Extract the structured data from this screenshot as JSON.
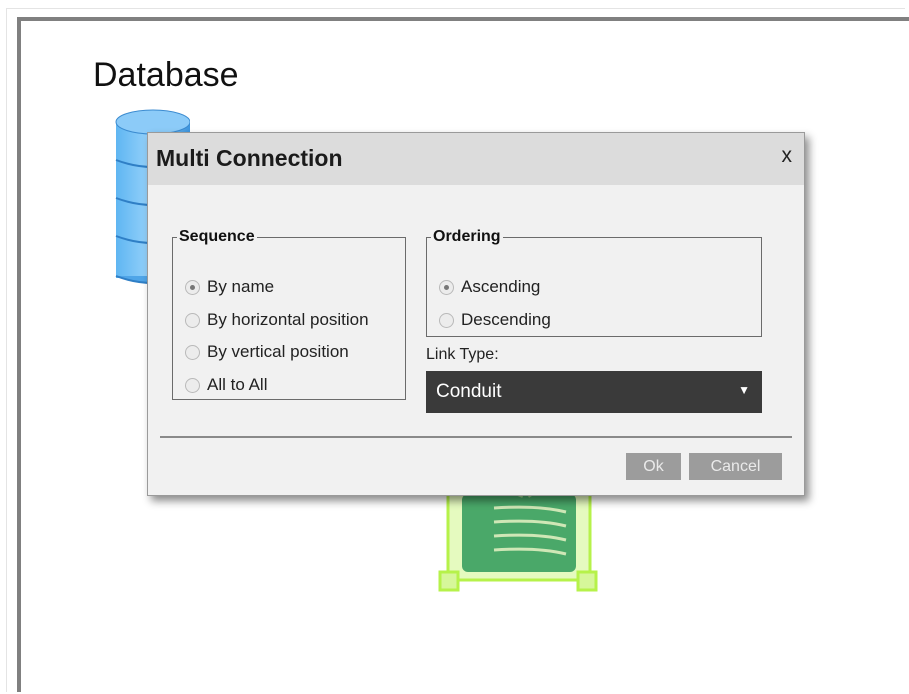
{
  "canvas": {
    "title": "Database"
  },
  "icons": {
    "database": "database-icon",
    "router": "router-icon"
  },
  "dialog": {
    "title": "Multi Connection",
    "close_label": "x",
    "sequence": {
      "legend": "Sequence",
      "options": [
        "By name",
        "By horizontal position",
        "By vertical position",
        "All to All"
      ],
      "selected": "By name"
    },
    "ordering": {
      "legend": "Ordering",
      "options": [
        "Ascending",
        "Descending"
      ],
      "selected": "Ascending"
    },
    "link_type": {
      "label": "Link Type:",
      "value": "Conduit"
    },
    "buttons": {
      "ok": "Ok",
      "cancel": "Cancel"
    }
  },
  "colors": {
    "select_bg": "#3a3a3a",
    "button_bg": "#9c9c9c",
    "router_highlight": "#b6f24a"
  }
}
